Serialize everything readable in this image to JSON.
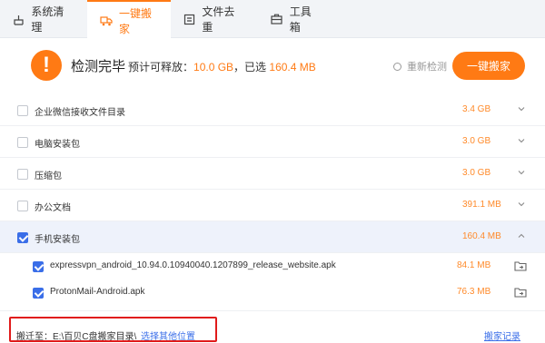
{
  "tabs": [
    {
      "label": "系统清理",
      "icon": "broom-icon"
    },
    {
      "label": "一键搬家",
      "icon": "truck-icon",
      "active": true
    },
    {
      "label": "文件去重",
      "icon": "duplicate-icon"
    },
    {
      "label": "工具箱",
      "icon": "toolbox-icon"
    }
  ],
  "header": {
    "status": "检测完毕",
    "summary_prefix": "预计可释放：",
    "release_size": "10.0 GB",
    "selected_prefix": "，已选",
    "selected_size": "160.4 MB",
    "rescan": "重新检测",
    "move_button": "一键搬家",
    "warning_glyph": "!"
  },
  "rows": [
    {
      "name": "企业微信接收文件目录",
      "size": "3.4 GB",
      "checked": false
    },
    {
      "name": "电脑安装包",
      "size": "3.0 GB",
      "checked": false
    },
    {
      "name": "压缩包",
      "size": "3.0 GB",
      "checked": false
    },
    {
      "name": "办公文档",
      "size": "391.1 MB",
      "checked": false
    },
    {
      "name": "手机安装包",
      "size": "160.4 MB",
      "checked": true
    },
    {
      "name": "expressvpn_android_10.94.0.10940040.1207899_release_website.apk",
      "size": "84.1 MB",
      "checked": true
    },
    {
      "name": "ProtonMail-Android.apk",
      "size": "76.3 MB",
      "checked": true
    }
  ],
  "footer": {
    "label": "搬迁至：",
    "path": "E:\\百贝C盘搬家目录\\",
    "choose": "选择其他位置",
    "record": "搬家记录"
  },
  "colors": {
    "accent": "#ff7a14",
    "link": "#3a6ee8",
    "highlight_border": "#e01b1b"
  }
}
